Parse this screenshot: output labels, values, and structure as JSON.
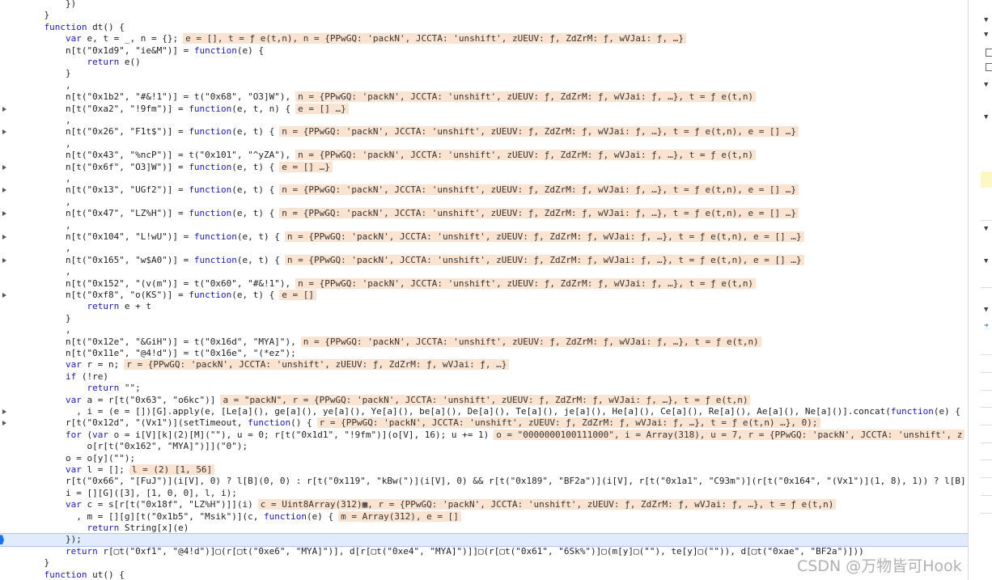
{
  "lines": [
    {
      "text": "        })",
      "value": ""
    },
    {
      "text": "    }",
      "value": ""
    },
    {
      "text": "    function dt() {",
      "value": ""
    },
    {
      "text": "        var e, t = _, n = {};",
      "value": "e = [], t = ƒ e(t,n), n = {PPwGQ: 'packN', JCCTA: 'unshift', zUEUV: ƒ, ZdZrM: ƒ, wVJai: ƒ, …}"
    },
    {
      "text": "        n[t(\"0x1d9\", \"ie&M\")] = function(e) {",
      "value": ""
    },
    {
      "text": "            return e()",
      "value": ""
    },
    {
      "text": "        }",
      "value": ""
    },
    {
      "text": "        ,",
      "value": ""
    },
    {
      "text": "        n[t(\"0x1b2\", \"#&!1\")] = t(\"0x68\", \"O3]W\"),",
      "value": "n = {PPwGQ: 'packN', JCCTA: 'unshift', zUEUV: ƒ, ZdZrM: ƒ, wVJai: ƒ, …}, t = ƒ e(t,n)"
    },
    {
      "text": "        n[t(\"0xa2\", \"!9fm\")] = function(e, t, n) {",
      "value": "e = [] …}"
    },
    {
      "text": "        ,",
      "value": ""
    },
    {
      "text": "        n[t(\"0x26\", \"F1t$\")] = function(e, t) {",
      "value": "n = {PPwGQ: 'packN', JCCTA: 'unshift', zUEUV: ƒ, ZdZrM: ƒ, wVJai: ƒ, …}, t = ƒ e(t,n), e = [] …}"
    },
    {
      "text": "        ,",
      "value": ""
    },
    {
      "text": "        n[t(\"0x43\", \"%ncP\")] = t(\"0x101\", \"^yZA\"),",
      "value": "n = {PPwGQ: 'packN', JCCTA: 'unshift', zUEUV: ƒ, ZdZrM: ƒ, wVJai: ƒ, …}, t = ƒ e(t,n)"
    },
    {
      "text": "        n[t(\"0x6f\", \"O3]W\")] = function(e, t) {",
      "value": "e = [] …}"
    },
    {
      "text": "        ,",
      "value": ""
    },
    {
      "text": "        n[t(\"0x13\", \"UGf2\")] = function(e, t) {",
      "value": "n = {PPwGQ: 'packN', JCCTA: 'unshift', zUEUV: ƒ, ZdZrM: ƒ, wVJai: ƒ, …}, t = ƒ e(t,n), e = [] …}"
    },
    {
      "text": "        ,",
      "value": ""
    },
    {
      "text": "        n[t(\"0x47\", \"LZ%H\")] = function(e, t) {",
      "value": "n = {PPwGQ: 'packN', JCCTA: 'unshift', zUEUV: ƒ, ZdZrM: ƒ, wVJai: ƒ, …}, t = ƒ e(t,n), e = [] …}"
    },
    {
      "text": "        ,",
      "value": ""
    },
    {
      "text": "        n[t(\"0x104\", \"L!wU\")] = function(e, t) {",
      "value": "n = {PPwGQ: 'packN', JCCTA: 'unshift', zUEUV: ƒ, ZdZrM: ƒ, wVJai: ƒ, …}, t = ƒ e(t,n), e = [] …}"
    },
    {
      "text": "        ,",
      "value": ""
    },
    {
      "text": "        n[t(\"0x165\", \"w$A0\")] = function(e, t) {",
      "value": "n = {PPwGQ: 'packN', JCCTA: 'unshift', zUEUV: ƒ, ZdZrM: ƒ, wVJai: ƒ, …}, t = ƒ e(t,n), e = [] …}"
    },
    {
      "text": "        ,",
      "value": ""
    },
    {
      "text": "        n[t(\"0x152\", \"(v(m\")] = t(\"0x60\", \"#&!1\"),",
      "value": "n = {PPwGQ: 'packN', JCCTA: 'unshift', zUEUV: ƒ, ZdZrM: ƒ, wVJai: ƒ, …}, t = ƒ e(t,n)"
    },
    {
      "text": "        n[t(\"0xf8\", \"o(KS\")] = function(e, t) {",
      "value": "e = []"
    },
    {
      "text": "            return e + t",
      "value": ""
    },
    {
      "text": "        }",
      "value": ""
    },
    {
      "text": "        ,",
      "value": ""
    },
    {
      "text": "        n[t(\"0x12e\", \"&GiH\")] = t(\"0x16d\", \"MYA]\"),",
      "value": "n = {PPwGQ: 'packN', JCCTA: 'unshift', zUEUV: ƒ, ZdZrM: ƒ, wVJai: ƒ, …}, t = ƒ e(t,n)"
    },
    {
      "text": "        n[t(\"0x11e\", \"@4!d\")] = t(\"0x16e\", \"(*ez\");",
      "value": ""
    },
    {
      "text": "        var r = n;",
      "value": "r = {PPwGQ: 'packN', JCCTA: 'unshift', zUEUV: ƒ, ZdZrM: ƒ, wVJai: ƒ, …}"
    },
    {
      "text": "        if (!re)",
      "value": ""
    },
    {
      "text": "            return \"\";",
      "value": ""
    },
    {
      "text": "        var a = r[t(\"0x63\", \"o6kc\")]",
      "value": "a = \"packN\", r = {PPwGQ: 'packN', JCCTA: 'unshift', zUEUV: ƒ, ZdZrM: ƒ, wVJai: ƒ, …}, t = ƒ e(t,n)"
    },
    {
      "text": "          , i = (e = [])[G].apply(e, [Le[a](), ge[a](), ye[a](), Ye[a](), be[a](), De[a](), Te[a](), je[a](), He[a](), Ce[a](), Re[a](), Ae[a](), Ne[a]()].concat(function(e) {",
      "value": ""
    },
    {
      "text": "        r[t(\"0x12d\", \"(Vx1\")](setTimeout, function() {",
      "value": "r = {PPwGQ: 'packN', JCCTA: 'unshift', zUEUV: ƒ, ZdZrM: ƒ, wVJai: ƒ, …}, t = ƒ e(t,n) …}, 0);"
    },
    {
      "text": "        for (var o = i[V][k](2)[M](\"\"), u = 0; r[t(\"0x1d1\", \"!9fm\")](o[V], 16); u += 1)",
      "value": "o = \"0000000100111000\", i = Array(318), u = 7, r = {PPwGQ: 'packN', JCCTA: 'unshift', z"
    },
    {
      "text": "            o[r[t(\"0x162\", \"MYA]\")]](\"0\");",
      "value": ""
    },
    {
      "text": "        o = o[y](\"\");",
      "value": ""
    },
    {
      "text": "        var l = [];",
      "value": "l = (2) [1, 56]"
    },
    {
      "text": "        r[t(\"0x66\", \"[FuJ\")](i[V], 0) ? l[B](0, 0) : r[t(\"0x119\", \"kBw(\")](i[V], 0) && r[t(\"0x189\", \"BF2a\")](i[V], r[t(\"0x1a1\", \"C93m\")](r[t(\"0x164\", \"(Vx1\")](1, 8), 1)) ? l[B]",
      "value": ""
    },
    {
      "text": "        i = [][G]([3], [1, 0, 0], l, i);",
      "value": ""
    },
    {
      "text": "        var c = s[r[t(\"0x18f\", \"LZ%H\")]](i)",
      "value": "c = Uint8Array(312)▦, r = {PPwGQ: 'packN', JCCTA: 'unshift', zUEUV: ƒ, ZdZrM: ƒ, wVJai: ƒ, …}, t = ƒ e(t,n)"
    },
    {
      "text": "          , m = [][g][t(\"0x1b5\", \"Msik\")](c, function(e) {",
      "value": "m = Array(312), e = []"
    },
    {
      "text": "            return String[x](e)",
      "value": ""
    },
    {
      "text": "        });",
      "value": ""
    },
    {
      "text": "        return r[▢t(\"0xf1\", \"@4!d\")]▢(r[▢t(\"0xe6\", \"MYA]\")], d[r[▢t(\"0xe4\", \"MYA]\")]]▢(r[▢t(\"0x61\", \"6Sk%\")]▢(m[y]▢(\"\"), te[y]▢(\"\")), d[▢t(\"0xae\", \"BF2a\")]))",
      "value": ""
    },
    {
      "text": "    }",
      "value": ""
    },
    {
      "text": "    function ut() {",
      "value": ""
    }
  ],
  "current_line_index": 46,
  "expandable_line_indices": [
    9,
    11,
    14,
    16,
    18,
    20,
    22,
    25,
    35,
    36
  ],
  "watermark": "CSDN @万物皆可Hook"
}
